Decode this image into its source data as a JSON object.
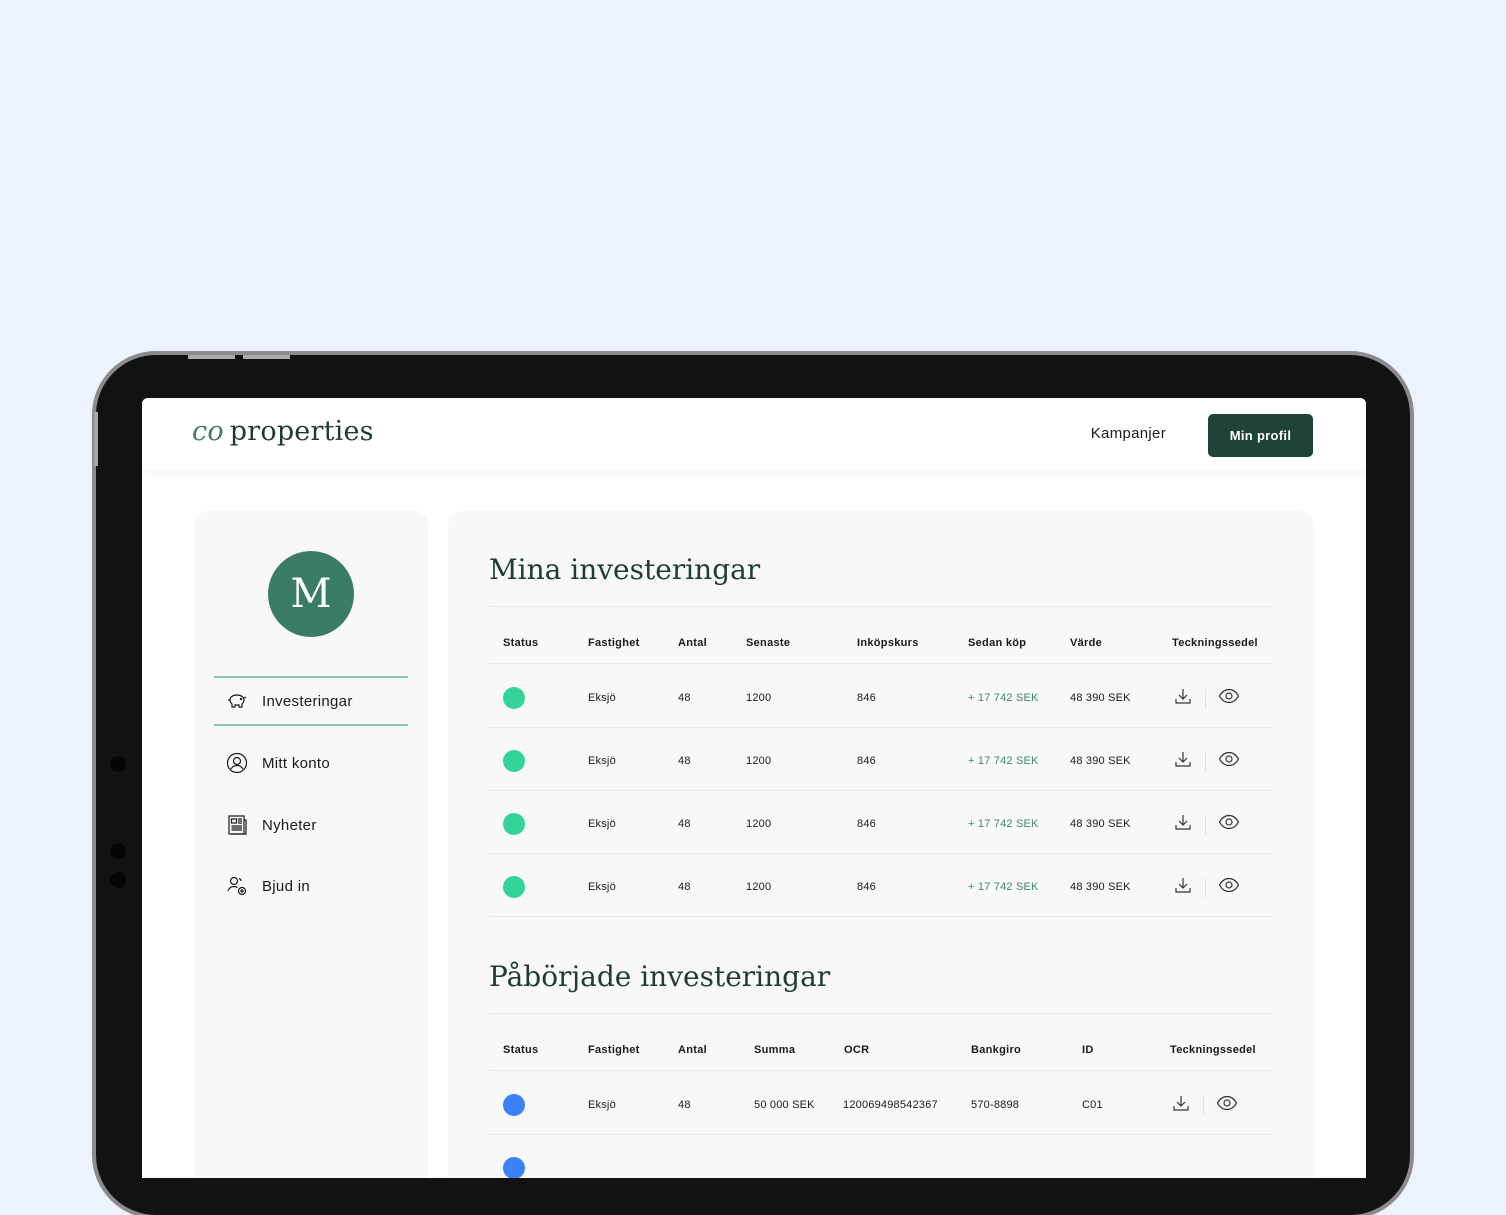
{
  "header": {
    "logo_mark": "co",
    "logo_text": "properties",
    "nav_link": "Kampanjer",
    "profile_button": "Min profil"
  },
  "sidebar": {
    "avatar_initial": "M",
    "items": [
      {
        "label": "Investeringar",
        "icon": "piggy-bank-icon",
        "active": true
      },
      {
        "label": "Mitt konto",
        "icon": "user-icon",
        "active": false
      },
      {
        "label": "Nyheter",
        "icon": "newspaper-icon",
        "active": false
      },
      {
        "label": "Bjud in",
        "icon": "invite-user-icon",
        "active": false
      }
    ]
  },
  "investments": {
    "title": "Mina investeringar",
    "columns": [
      "Status",
      "Fastighet",
      "Antal",
      "Senaste",
      "Inköpskurs",
      "Sedan köp",
      "Värde",
      "Teckningssedel"
    ],
    "rows": [
      {
        "status_color": "#34d399",
        "fastighet": "Eksjö",
        "antal": "48",
        "senaste": "1200",
        "inkopskurs": "846",
        "sedan_kop": "+ 17 742 SEK",
        "varde": "48 390 SEK"
      },
      {
        "status_color": "#34d399",
        "fastighet": "Eksjö",
        "antal": "48",
        "senaste": "1200",
        "inkopskurs": "846",
        "sedan_kop": "+ 17 742 SEK",
        "varde": "48 390 SEK"
      },
      {
        "status_color": "#34d399",
        "fastighet": "Eksjö",
        "antal": "48",
        "senaste": "1200",
        "inkopskurs": "846",
        "sedan_kop": "+ 17 742 SEK",
        "varde": "48 390 SEK"
      },
      {
        "status_color": "#34d399",
        "fastighet": "Eksjö",
        "antal": "48",
        "senaste": "1200",
        "inkopskurs": "846",
        "sedan_kop": "+ 17 742 SEK",
        "varde": "48 390 SEK"
      }
    ]
  },
  "started": {
    "title": "Påbörjade investeringar",
    "columns": [
      "Status",
      "Fastighet",
      "Antal",
      "Summa",
      "OCR",
      "Bankgiro",
      "ID",
      "Teckningssedel"
    ],
    "rows": [
      {
        "status_color": "#3b82f6",
        "fastighet": "Eksjö",
        "antal": "48",
        "summa": "50 000 SEK",
        "ocr": "120069498542367",
        "bankgiro": "570-8898",
        "id": "C01"
      }
    ]
  },
  "colors": {
    "background": "#ecf2fe",
    "brand_dark": "#1e4237",
    "brand_green": "#3a7c66",
    "positive": "#3a8c68"
  }
}
